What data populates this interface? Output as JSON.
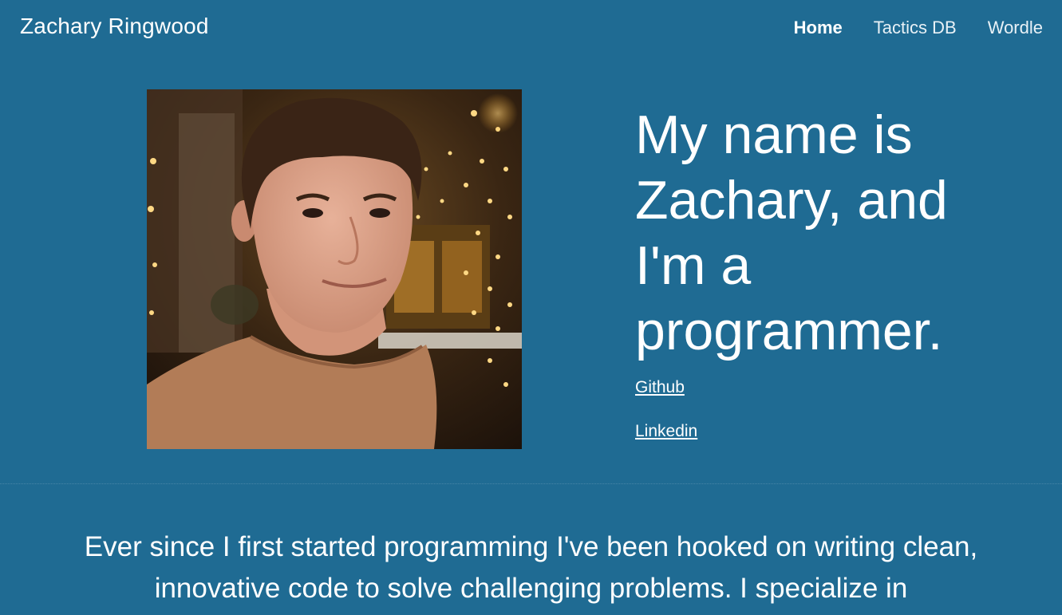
{
  "header": {
    "brand": "Zachary Ringwood",
    "nav": [
      {
        "label": "Home",
        "active": true
      },
      {
        "label": "Tactics DB",
        "active": false
      },
      {
        "label": "Wordle",
        "active": false
      }
    ]
  },
  "hero": {
    "headline": "My name is Zachary, and I'm a programmer.",
    "links": [
      {
        "label": "Github"
      },
      {
        "label": "Linkedin"
      }
    ]
  },
  "intro": {
    "text": "Ever since I first started programming I've been hooked on writing clean, innovative code to solve challenging problems. I specialize in"
  },
  "colors": {
    "background": "#1f6b93",
    "text": "#ffffff"
  }
}
